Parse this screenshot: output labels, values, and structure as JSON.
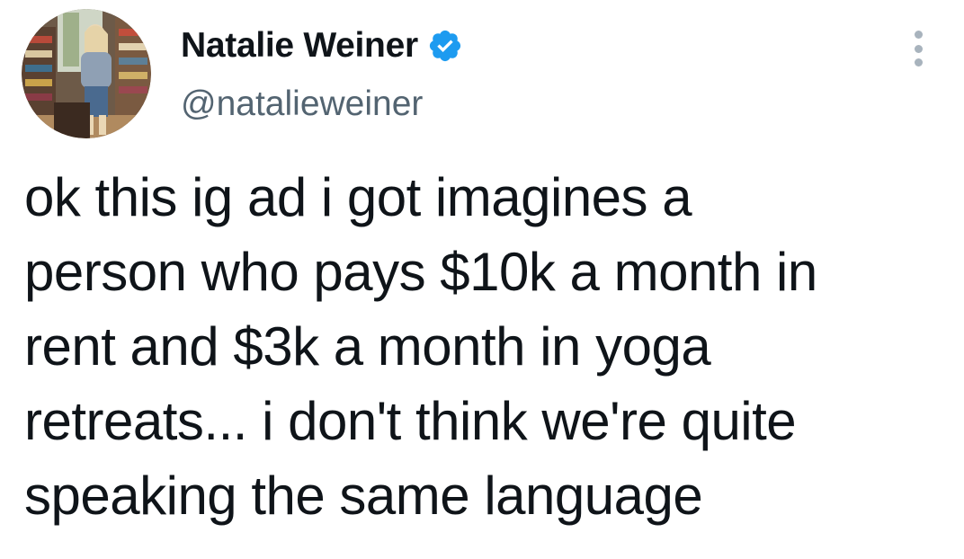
{
  "author": {
    "display_name": "Natalie Weiner",
    "handle": "@natalieweiner",
    "verified": true,
    "avatar_icon": "profile-photo-icon"
  },
  "tweet": {
    "lines": [
      "ok this ig ad i got imagines a",
      "person who pays $10k a month in",
      "rent and $3k a month in yoga",
      "retreats... i don't think we're quite",
      "speaking the same language"
    ]
  },
  "menu": {
    "icon": "more-options-icon"
  },
  "colors": {
    "text_primary": "#0f1419",
    "text_secondary": "#536471",
    "verified_blue": "#1d9bf0",
    "more_dots": "#a8b3bd",
    "background": "#ffffff"
  }
}
